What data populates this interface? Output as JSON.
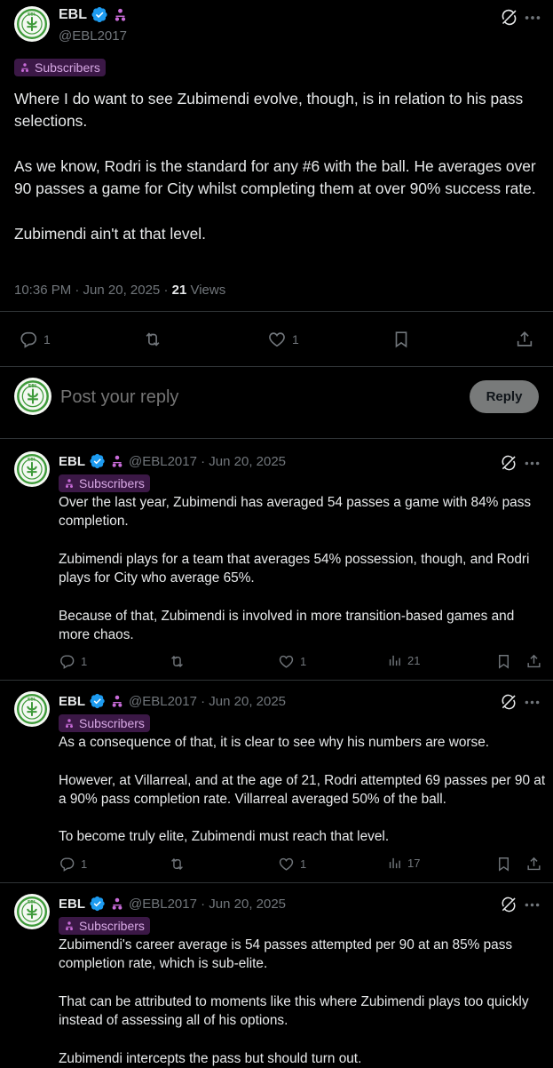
{
  "main": {
    "name": "EBL",
    "handle": "@EBL2017",
    "badge": "Subscribers",
    "text": "Where I do want to see Zubimendi evolve, though, is in relation to his pass selections.\n\nAs we know, Rodri is the standard for any #6 with the ball. He averages over 90 passes a game for City whilst completing them at over 90% success rate.\n\nZubimendi ain't at that level.",
    "timestamp": "10:36 PM · Jun 20, 2025 · ",
    "views_count": "21",
    "views_label": " Views",
    "replies": "1",
    "likes": "1"
  },
  "reply_box": {
    "placeholder": "Post your reply",
    "button": "Reply"
  },
  "replies": [
    {
      "name": "EBL",
      "handle_date": "@EBL2017 · Jun 20, 2025",
      "badge": "Subscribers",
      "text": "Over the last year, Zubimendi has averaged 54 passes a game with 84% pass completion.\n\nZubimendi plays for a team that averages 54% possession, though, and Rodri plays for City who average 65%.\n\nBecause of that, Zubimendi is involved in more transition-based games and more chaos.",
      "replies": "1",
      "likes": "1",
      "views": "21"
    },
    {
      "name": "EBL",
      "handle_date": "@EBL2017 · Jun 20, 2025",
      "badge": "Subscribers",
      "text": "As a consequence of that, it is clear to see why his numbers are worse.\n\nHowever, at Villarreal, and at the age of 21, Rodri attempted 69 passes per 90 at a 90% pass completion rate. Villarreal averaged 50% of the ball.\n\nTo become truly elite, Zubimendi must reach that level.",
      "replies": "1",
      "likes": "1",
      "views": "17"
    },
    {
      "name": "EBL",
      "handle_date": "@EBL2017 · Jun 20, 2025",
      "badge": "Subscribers",
      "text": "Zubimendi's career average is 54 passes attempted per 90 at an 85% pass completion rate, which is sub-elite.\n\nThat can be attributed to moments like this where Zubimendi plays too quickly instead of assessing all of his options.\n\nZubimendi intercepts the pass but should turn out.",
      "replies": "",
      "likes": "",
      "views": ""
    }
  ],
  "colors": {
    "background": "#000000",
    "text": "#e7e9ea",
    "muted": "#71767b",
    "verified": "#1d9bf0",
    "subscriber": "#c96cd9",
    "badge_bg": "#3b1846"
  },
  "icons": [
    "grok-icon",
    "more-icon",
    "verified-badge-icon",
    "subscriber-icon",
    "reply-icon",
    "repost-icon",
    "like-icon",
    "views-icon",
    "bookmark-icon",
    "share-icon"
  ]
}
